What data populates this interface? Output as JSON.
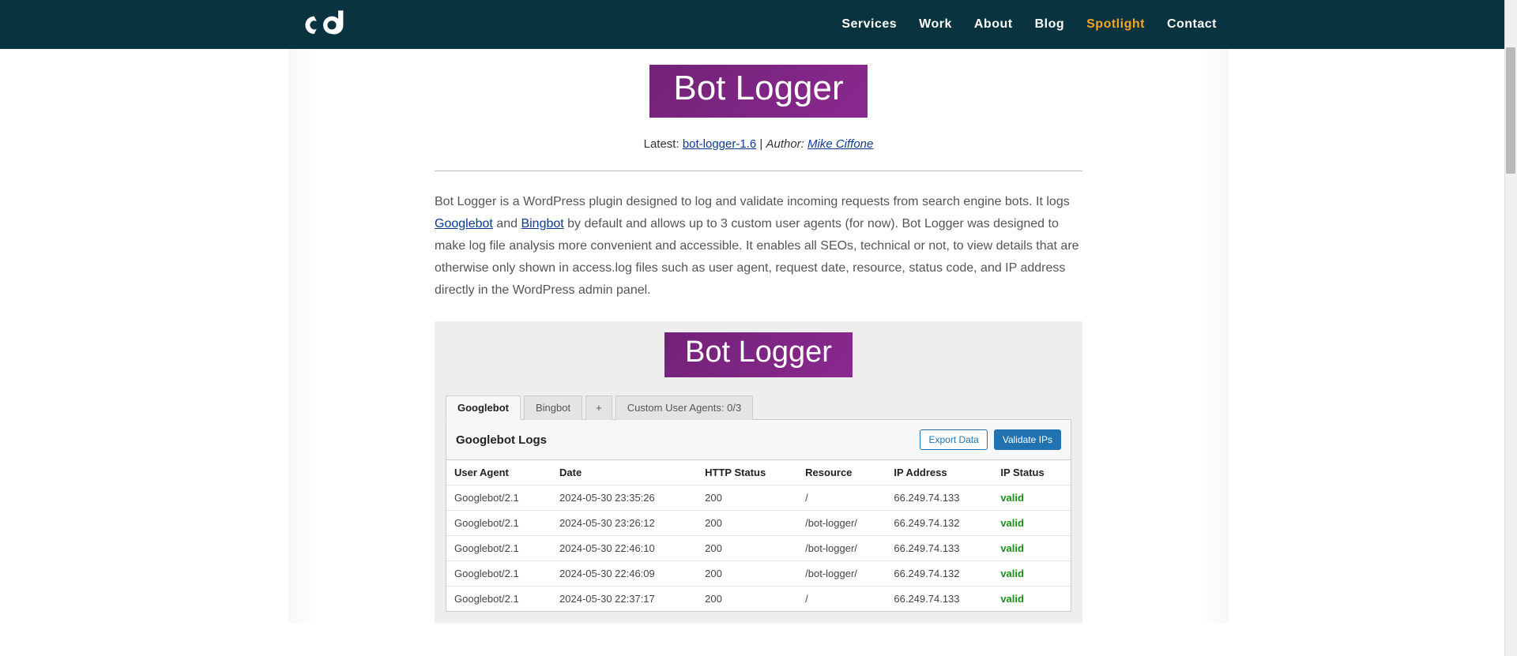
{
  "nav": {
    "items": [
      {
        "label": "Services",
        "active": false
      },
      {
        "label": "Work",
        "active": false
      },
      {
        "label": "About",
        "active": false
      },
      {
        "label": "Blog",
        "active": false
      },
      {
        "label": "Spotlight",
        "active": true
      },
      {
        "label": "Contact",
        "active": false
      }
    ]
  },
  "hero": {
    "title": "Bot Logger",
    "latest_label": "Latest:",
    "latest_link": "bot-logger-1.6",
    "divider": " | ",
    "author_label": "Author: ",
    "author_name": "Mike Ciffone"
  },
  "body": {
    "p1a": "Bot Logger is a WordPress plugin designed to log and validate incoming requests from search engine bots. It logs ",
    "link1": "Googlebot",
    "p1b": " and ",
    "link2": "Bingbot",
    "p1c": " by default and allows up to 3 custom user agents (for now). Bot Logger was designed to make log file analysis more convenient and accessible. It enables all SEOs, technical or not, to view details that are otherwise only shown in access.log files such as user agent, request date, resource, status code, and IP address directly in the WordPress admin panel."
  },
  "panel": {
    "badge": "Bot Logger",
    "tabs": [
      {
        "label": "Googlebot",
        "active": true
      },
      {
        "label": "Bingbot",
        "active": false
      },
      {
        "label": "+",
        "active": false,
        "plus": true
      },
      {
        "label": "Custom User Agents: 0/3",
        "active": false
      }
    ],
    "card_title": "Googlebot Logs",
    "export_btn": "Export Data",
    "validate_btn": "Validate IPs",
    "columns": [
      "User Agent",
      "Date",
      "HTTP Status",
      "Resource",
      "IP Address",
      "IP Status"
    ],
    "rows": [
      {
        "ua": "Googlebot/2.1",
        "date": "2024-05-30 23:35:26",
        "status": "200",
        "resource": "/",
        "ip": "66.249.74.133",
        "ipstatus": "valid"
      },
      {
        "ua": "Googlebot/2.1",
        "date": "2024-05-30 23:26:12",
        "status": "200",
        "resource": "/bot-logger/",
        "ip": "66.249.74.132",
        "ipstatus": "valid"
      },
      {
        "ua": "Googlebot/2.1",
        "date": "2024-05-30 22:46:10",
        "status": "200",
        "resource": "/bot-logger/",
        "ip": "66.249.74.133",
        "ipstatus": "valid"
      },
      {
        "ua": "Googlebot/2.1",
        "date": "2024-05-30 22:46:09",
        "status": "200",
        "resource": "/bot-logger/",
        "ip": "66.249.74.132",
        "ipstatus": "valid"
      },
      {
        "ua": "Googlebot/2.1",
        "date": "2024-05-30 22:37:17",
        "status": "200",
        "resource": "/",
        "ip": "66.249.74.133",
        "ipstatus": "valid"
      }
    ]
  }
}
